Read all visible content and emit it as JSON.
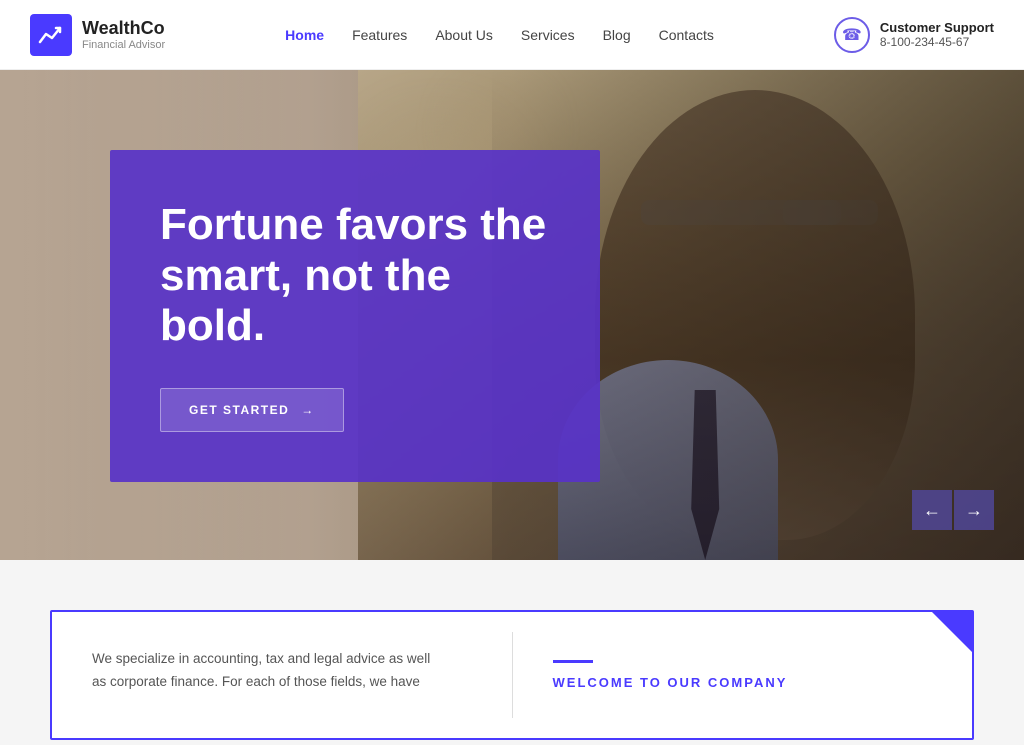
{
  "header": {
    "logo_name": "WealthCo",
    "logo_sub": "Financial Advisor",
    "nav": [
      {
        "label": "Home",
        "active": true
      },
      {
        "label": "Features",
        "active": false
      },
      {
        "label": "About Us",
        "active": false
      },
      {
        "label": "Services",
        "active": false
      },
      {
        "label": "Blog",
        "active": false
      },
      {
        "label": "Contacts",
        "active": false
      }
    ],
    "support_label": "Customer Support",
    "support_number": "8-100-234-45-67"
  },
  "hero": {
    "headline": "Fortune favors the smart, not the bold.",
    "cta_label": "GET STARTED",
    "arrow_left": "←",
    "arrow_right": "→"
  },
  "below": {
    "welcome_text_line1": "We specialize in accounting, tax and legal advice as well",
    "welcome_text_line2": "as corporate finance. For each of those fields, we have",
    "welcome_title": "WELCOME TO OUR COMPANY"
  }
}
